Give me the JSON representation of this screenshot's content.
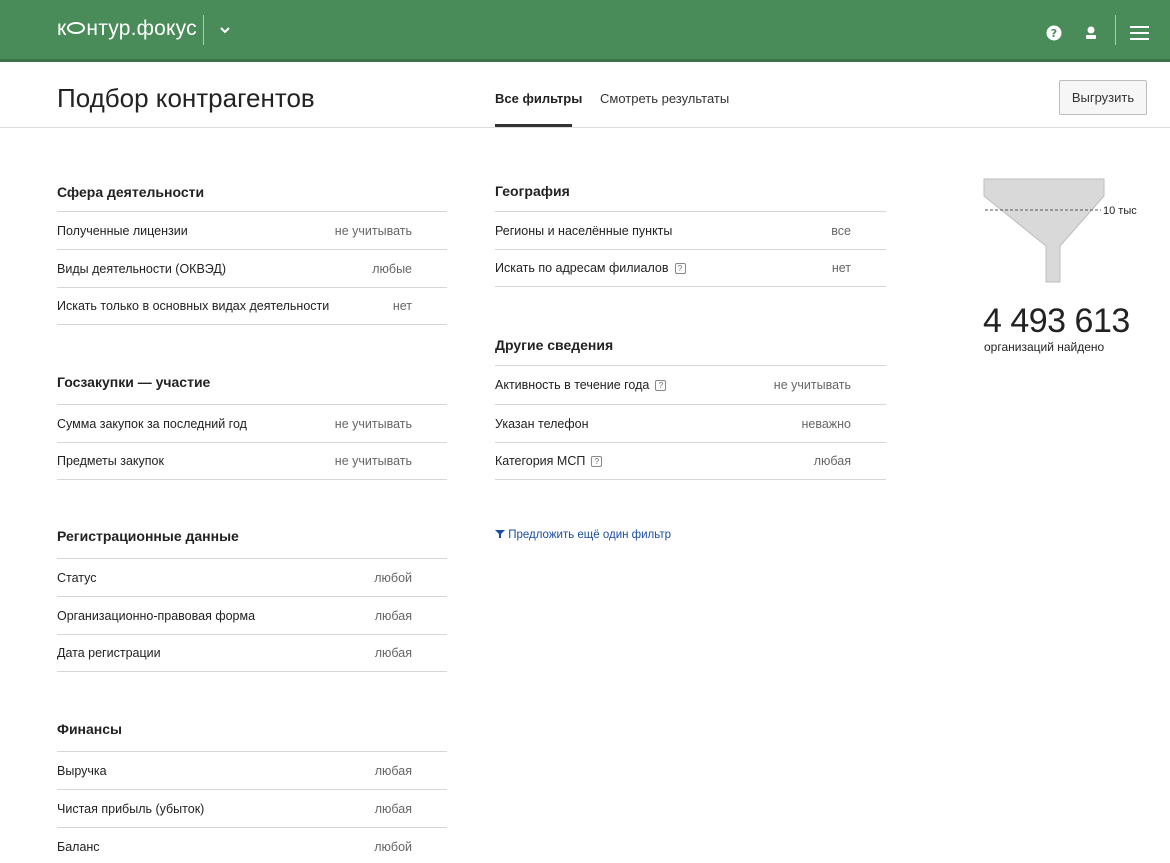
{
  "brand": {
    "logo_prefix": "к",
    "logo_suffix": "нтур.фокус"
  },
  "page": {
    "title": "Подбор контрагентов",
    "tabs": [
      {
        "label": "Все фильтры"
      },
      {
        "label": "Смотреть результаты"
      }
    ],
    "export_label": "Выгрузить"
  },
  "sections": {
    "activity": {
      "title": "Сфера деятельности",
      "rows": [
        {
          "label": "Полученные лицензии",
          "value": "не учитывать"
        },
        {
          "label": "Виды деятельности (ОКВЭД)",
          "value": "любые"
        },
        {
          "label": "Искать только в основных видах деятельности",
          "value": "нет"
        }
      ]
    },
    "procurement": {
      "title": "Госзакупки — участие",
      "rows": [
        {
          "label": "Сумма закупок за последний год",
          "value": "не учитывать"
        },
        {
          "label": "Предметы закупок",
          "value": "не учитывать"
        }
      ]
    },
    "registration": {
      "title": "Регистрационные данные",
      "rows": [
        {
          "label": "Статус",
          "value": "любой"
        },
        {
          "label": "Организационно-правовая форма",
          "value": "любая"
        },
        {
          "label": "Дата регистрации",
          "value": "любая"
        }
      ]
    },
    "finance": {
      "title": "Финансы",
      "rows": [
        {
          "label": "Выручка",
          "value": "любая"
        },
        {
          "label": "Чистая прибыль (убыток)",
          "value": "любая"
        },
        {
          "label": "Баланс",
          "value": "любой"
        }
      ]
    },
    "geography": {
      "title": "География",
      "rows": [
        {
          "label": "Регионы и населённые пункты",
          "value": "все"
        },
        {
          "label": "Искать по адресам филиалов",
          "value": "нет"
        }
      ]
    },
    "other": {
      "title": "Другие сведения",
      "rows": [
        {
          "label": "Активность в течение года",
          "value": "не учитывать"
        },
        {
          "label": "Указан телефон",
          "value": "неважно"
        },
        {
          "label": "Категория МСП",
          "value": "любая"
        }
      ]
    }
  },
  "suggest_filter": "Предложить ещё один фильтр",
  "results": {
    "threshold_label": "10 тыс",
    "count": "4 493 613",
    "count_label": "организаций найдено"
  },
  "colors": {
    "header_bg": "#4a8c59",
    "link": "#1a4da6"
  },
  "icons": [
    "chevron-down-icon",
    "help-icon",
    "user-icon",
    "menu-icon",
    "filter-icon",
    "funnel-icon",
    "question-box-icon"
  ]
}
